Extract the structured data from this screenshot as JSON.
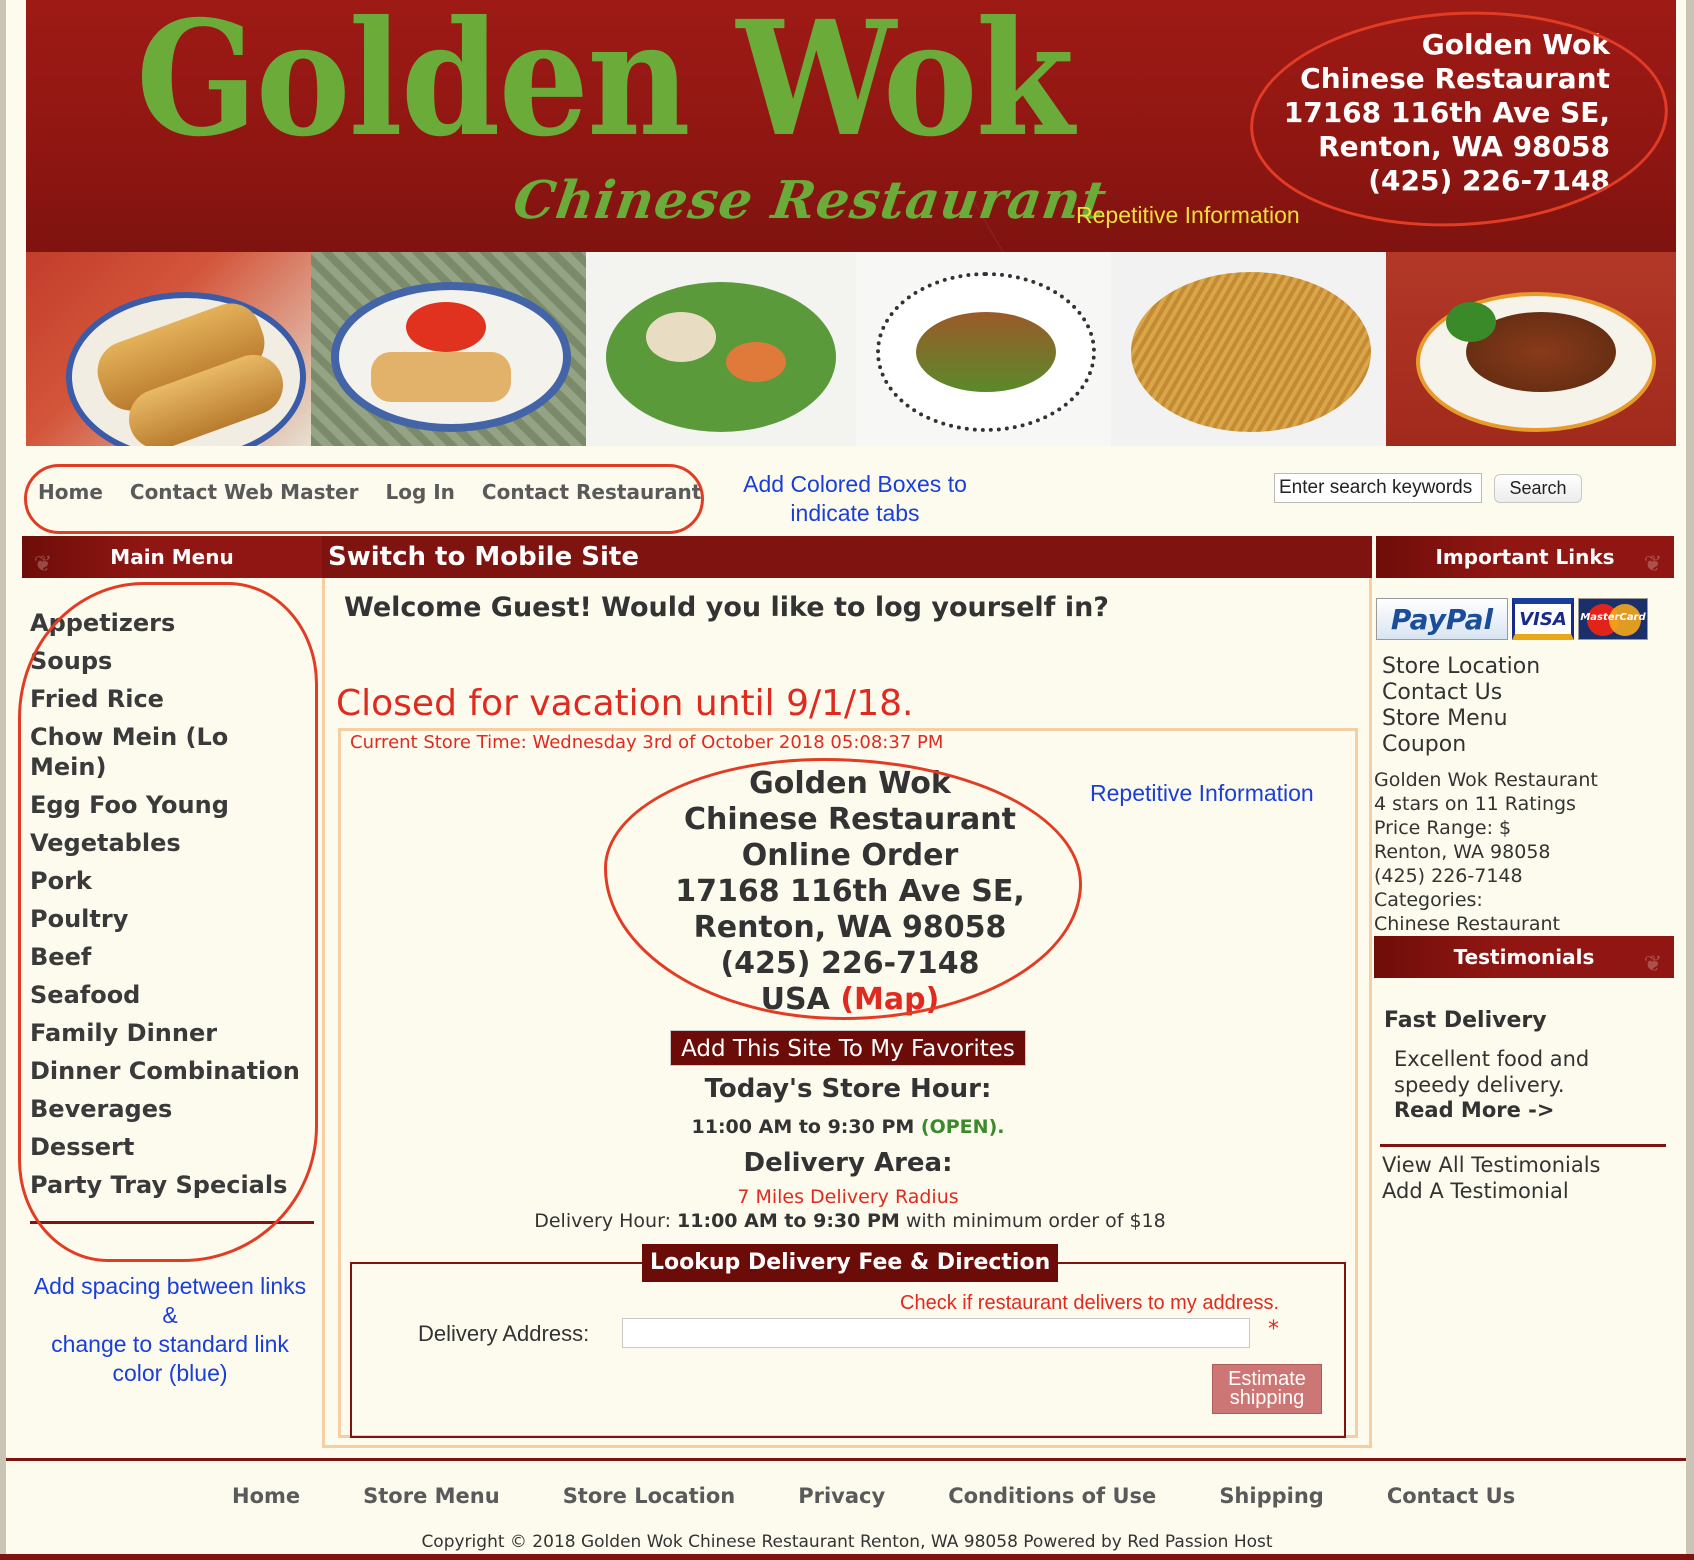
{
  "header": {
    "logo_main": "Golden Wok",
    "logo_sub": "Chinese Restaurant",
    "annotation": "Repetitive Information",
    "address_lines": [
      "Golden Wok",
      "Chinese Restaurant",
      "17168 116th Ave SE,",
      "Renton, WA 98058",
      "(425) 226-7148"
    ]
  },
  "top_nav": {
    "items": [
      "Home",
      "Contact Web Master",
      "Log In",
      "Contact Restaurant"
    ],
    "annotation_lines": [
      "Add Colored Boxes to",
      "indicate tabs"
    ],
    "search_placeholder": "Enter search keywords",
    "search_value": "Enter search keywords",
    "search_button": "Search"
  },
  "left": {
    "heading": "Main Menu",
    "items": [
      "Appetizers",
      "Soups",
      "Fried Rice",
      "Chow Mein (Lo Mein)",
      "Egg Foo Young",
      "Vegetables",
      "Pork",
      "Poultry",
      "Beef",
      "Seafood",
      "Family Dinner",
      "Dinner Combination",
      "Beverages",
      "Dessert",
      "Party Tray Specials"
    ],
    "annotation_lines": [
      "Add spacing between links",
      "&",
      "change to standard link",
      "color (blue)"
    ]
  },
  "center": {
    "heading": "Switch to Mobile Site",
    "welcome": "Welcome Guest! Would you like to log yourself in?",
    "closed_notice": "Closed for vacation until 9/1/18.",
    "store_time": "Current Store Time: Wednesday 3rd of October 2018 05:08:37 PM",
    "annotation": "Repetitive Information",
    "store_lines": [
      "Golden Wok",
      "Chinese Restaurant",
      "Online Order",
      "17168 116th Ave SE,",
      "Renton, WA 98058",
      "(425) 226-7148"
    ],
    "country": "USA",
    "map_link": "(Map)",
    "favorites_button": "Add This Site To My Favorites",
    "hours_title": "Today's Store Hour:",
    "hours_value": "11:00 AM to 9:30 PM",
    "hours_status": "(OPEN).",
    "delivery_title": "Delivery Area:",
    "delivery_radius": "7 Miles Delivery Radius",
    "delivery_hour_label": "Delivery Hour:",
    "delivery_hour_value": "11:00 AM to 9:30 PM",
    "delivery_hour_suffix": "with minimum order of $18",
    "lookup_title": "Lookup Delivery Fee & Direction",
    "check_text": "Check if restaurant delivers to my address.",
    "address_label": "Delivery Address:",
    "address_value": "",
    "required_mark": "*",
    "estimate_line1": "Estimate",
    "estimate_line2": "shipping"
  },
  "right": {
    "heading": "Important Links",
    "payment_badges": [
      "PayPal",
      "VISA",
      "MasterCard"
    ],
    "links": [
      "Store Location",
      "Contact Us",
      "Store Menu",
      "Coupon"
    ],
    "info_lines": [
      "Golden Wok Restaurant",
      "4 stars on 11 Ratings",
      "Price Range: $",
      "Renton, WA 98058",
      "(425) 226-7148",
      "Categories:",
      "Chinese Restaurant"
    ],
    "testimonials_heading": "Testimonials",
    "testimonial_title": "Fast Delivery",
    "testimonial_body": "Excellent food and speedy delivery.",
    "read_more": "Read More ->",
    "testimonial_links": [
      "View All Testimonials",
      "Add A Testimonial"
    ]
  },
  "footer": {
    "nav": [
      "Home",
      "Store Menu",
      "Store Location",
      "Privacy",
      "Conditions of Use",
      "Shipping",
      "Contact Us"
    ],
    "copyright": "Copyright © 2018 Golden Wok Chinese Restaurant Renton, WA 98058 Powered by Red Passion Host"
  },
  "colors": {
    "brand_red": "#8f1612",
    "logo_green": "#6aab3a",
    "annotation_blue": "#1a3fd8",
    "alert_red": "#e02a1f",
    "open_green": "#3b8a2a",
    "markup_circle": "#e23c24"
  }
}
